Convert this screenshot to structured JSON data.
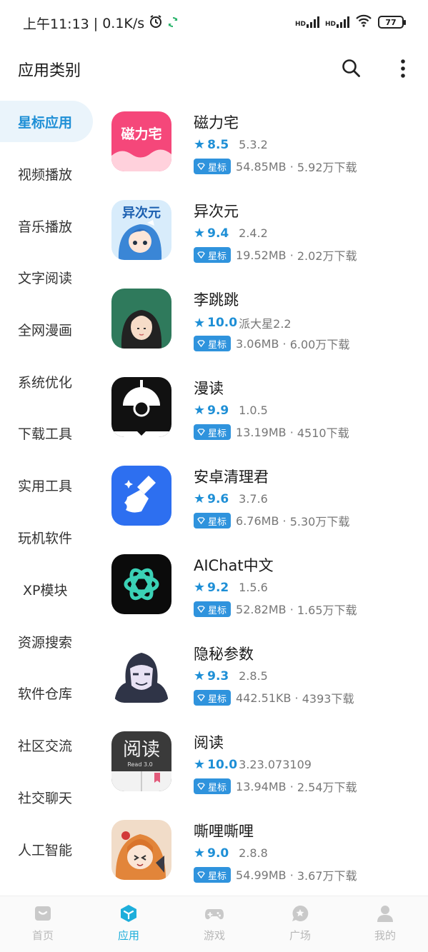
{
  "status_bar": {
    "time": "上午11:13",
    "net_speed": "| 0.1K/s",
    "sim1_label": "HD",
    "sim2_label": "HD",
    "battery": "77"
  },
  "header": {
    "title": "应用类别"
  },
  "sidebar": {
    "items": [
      {
        "label": "星标应用",
        "active": true
      },
      {
        "label": "视频播放"
      },
      {
        "label": "音乐播放"
      },
      {
        "label": "文字阅读"
      },
      {
        "label": "全网漫画"
      },
      {
        "label": "系统优化"
      },
      {
        "label": "下载工具"
      },
      {
        "label": "实用工具"
      },
      {
        "label": "玩机软件"
      },
      {
        "label": "XP模块"
      },
      {
        "label": "资源搜索"
      },
      {
        "label": "软件仓库"
      },
      {
        "label": "社区交流"
      },
      {
        "label": "社交聊天"
      },
      {
        "label": "人工智能"
      }
    ]
  },
  "badge_label": "星标",
  "apps": [
    {
      "name": "磁力宅",
      "rating": "8.5",
      "version": "5.3.2",
      "size": "54.85MB",
      "downloads": "5.92万下载",
      "icon": "ciliz-icon"
    },
    {
      "name": "异次元",
      "rating": "9.4",
      "version": "2.4.2",
      "size": "19.52MB",
      "downloads": "2.02万下载",
      "icon": "yiciyuan-icon"
    },
    {
      "name": "李跳跳",
      "rating": "10.0",
      "version": "派大星2.2",
      "size": "3.06MB",
      "downloads": "6.00万下载",
      "icon": "litiaotiao-icon"
    },
    {
      "name": "漫读",
      "rating": "9.9",
      "version": "1.0.5",
      "size": "13.19MB",
      "downloads": "4510下载",
      "icon": "mandu-icon"
    },
    {
      "name": "安卓清理君",
      "rating": "9.6",
      "version": "3.7.6",
      "size": "6.76MB",
      "downloads": "5.30万下载",
      "icon": "cleaner-icon"
    },
    {
      "name": "AIChat中文",
      "rating": "9.2",
      "version": "1.5.6",
      "size": "52.82MB",
      "downloads": "1.65万下载",
      "icon": "aichat-icon"
    },
    {
      "name": "隐秘参数",
      "rating": "9.3",
      "version": "2.8.5",
      "size": "442.51KB",
      "downloads": "4393下载",
      "icon": "hacker-icon"
    },
    {
      "name": "阅读",
      "rating": "10.0",
      "version": "3.23.073109",
      "size": "13.94MB",
      "downloads": "2.54万下载",
      "icon": "yuedu-icon",
      "icon_text": "阅读",
      "icon_subtext": "Read 3.0"
    },
    {
      "name": "嘶哩嘶哩",
      "rating": "9.0",
      "version": "2.8.8",
      "size": "54.99MB",
      "downloads": "3.67万下载",
      "icon": "silisili-icon"
    }
  ],
  "bottom_nav": [
    {
      "label": "首页",
      "icon": "home-icon"
    },
    {
      "label": "应用",
      "icon": "cube-icon",
      "active": true
    },
    {
      "label": "游戏",
      "icon": "gamepad-icon"
    },
    {
      "label": "广场",
      "icon": "chat-bubble-icon"
    },
    {
      "label": "我的",
      "icon": "person-icon"
    }
  ],
  "colors": {
    "accent": "#1e8fd6",
    "badge": "#2f93dd",
    "nav_active": "#1eaedb",
    "sidebar_active_bg": "#eaf4fb"
  }
}
